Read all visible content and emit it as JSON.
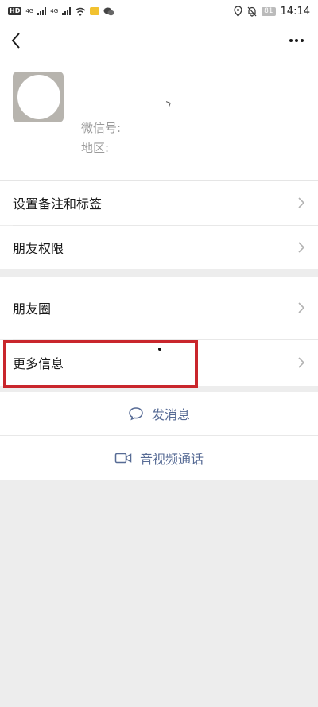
{
  "status_bar": {
    "hd_label": "HD",
    "net_label_1": "4G",
    "net_label_2": "4G",
    "battery": "81",
    "time": "14:14"
  },
  "nav": {
    "back_icon": "chevron-left-icon",
    "more_icon": "more-dots-icon"
  },
  "profile": {
    "wechat_id_label": "微信号:",
    "region_label": "地区:",
    "region_value": "",
    "name_partial": ""
  },
  "menu": {
    "remark_tags": "设置备注和标签",
    "friend_permissions": "朋友权限",
    "moments": "朋友圈",
    "more_info": "更多信息"
  },
  "actions": {
    "send_message": "发消息",
    "video_call": "音视频通话"
  },
  "colors": {
    "accent": "#576b95",
    "highlight": "#c9262c",
    "background": "#ededed"
  }
}
